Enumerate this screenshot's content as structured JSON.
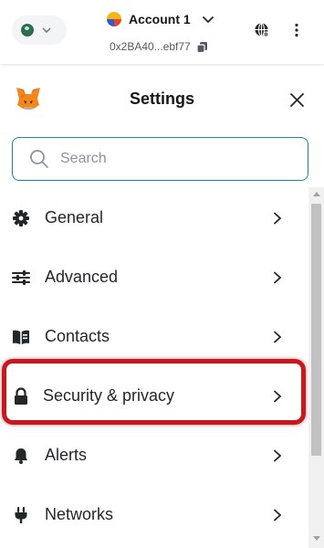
{
  "topbar": {
    "network_icon": "network-status-icon",
    "account_name": "Account 1",
    "address": "0x2BA40...ebf77",
    "account_menu_icon": "chevron-down-icon",
    "copy_icon": "copy-icon",
    "connected_sites_icon": "globe-icon",
    "more_icon": "kebab-menu-icon"
  },
  "header": {
    "logo_icon": "metamask-fox-icon",
    "title": "Settings",
    "close_icon": "close-icon"
  },
  "search": {
    "placeholder": "Search",
    "value": "",
    "icon": "search-icon"
  },
  "menu": {
    "items": [
      {
        "label": "General",
        "icon": "gear-icon"
      },
      {
        "label": "Advanced",
        "icon": "sliders-icon"
      },
      {
        "label": "Contacts",
        "icon": "book-icon"
      },
      {
        "label": "Security & privacy",
        "icon": "lock-icon",
        "highlighted": true
      },
      {
        "label": "Alerts",
        "icon": "bell-icon"
      },
      {
        "label": "Networks",
        "icon": "plug-icon"
      }
    ]
  },
  "colors": {
    "accent": "#1f7ec8",
    "highlight": "#c8181f",
    "text": "#24272a",
    "muted": "#535a61"
  }
}
